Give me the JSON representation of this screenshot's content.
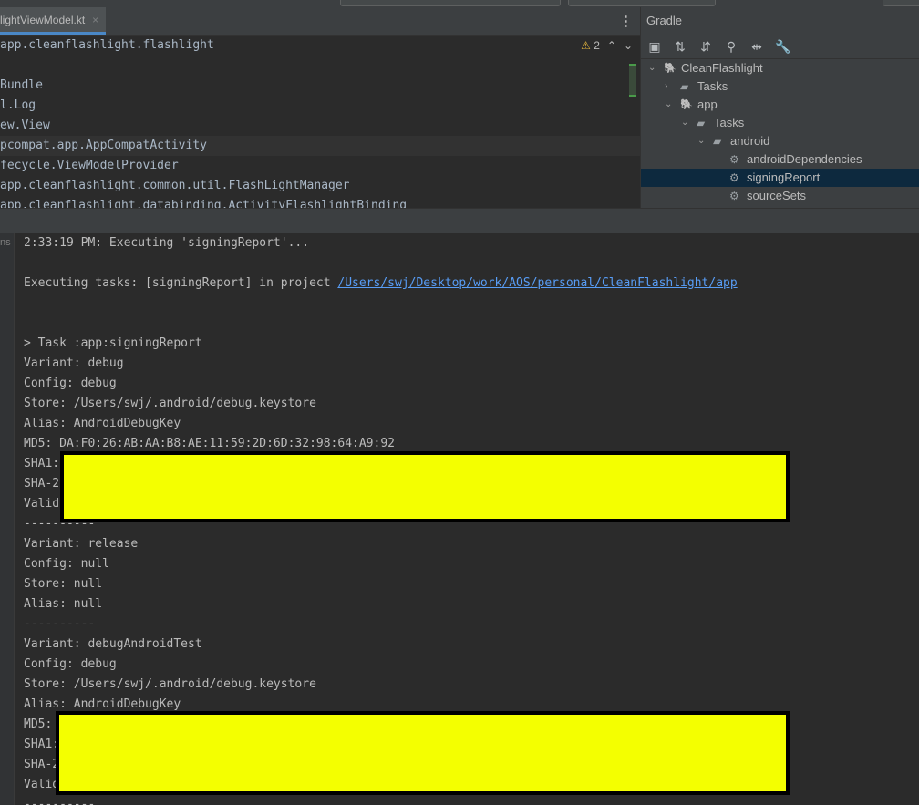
{
  "editor": {
    "tab_title": "lightViewModel.kt",
    "tab_close": "×",
    "menu_glyph": "⋮",
    "warning_icon": "warning-icon",
    "warning_count": "2",
    "nav_up": "⌃",
    "nav_down": "⌄",
    "lines": [
      "app.cleanflashlight.flashlight",
      "",
      "Bundle",
      "l.Log",
      "ew.View",
      "pcompat.app.AppCompatActivity",
      "fecycle.ViewModelProvider",
      "app.cleanflashlight.common.util.FlashLightManager",
      "app.cleanflashlight.databinding.ActivityFlashlightBinding"
    ]
  },
  "gradle": {
    "title": "Gradle",
    "tools": [
      "▣",
      "⇅",
      "⇵",
      "⚲",
      "⇹",
      "🔧"
    ],
    "tree": [
      {
        "label": "CleanFlashlight",
        "arrow": "⌄",
        "icon": "elephant-icon",
        "depth": 0,
        "selected": false
      },
      {
        "label": "Tasks",
        "arrow": "›",
        "icon": "folder-gear-icon",
        "depth": 1,
        "selected": false
      },
      {
        "label": "app",
        "arrow": "⌄",
        "icon": "elephant-icon",
        "depth": 1,
        "selected": false
      },
      {
        "label": "Tasks",
        "arrow": "⌄",
        "icon": "folder-gear-icon",
        "depth": 2,
        "selected": false
      },
      {
        "label": "android",
        "arrow": "⌄",
        "icon": "folder-gear-icon",
        "depth": 3,
        "selected": false
      },
      {
        "label": "androidDependencies",
        "arrow": "",
        "icon": "gear-icon",
        "depth": 4,
        "selected": false
      },
      {
        "label": "signingReport",
        "arrow": "",
        "icon": "gear-icon",
        "depth": 4,
        "selected": true
      },
      {
        "label": "sourceSets",
        "arrow": "",
        "icon": "gear-icon",
        "depth": 4,
        "selected": false
      }
    ]
  },
  "console": {
    "gutter_text": "ns",
    "line1": "2:33:19 PM: Executing 'signingReport'...",
    "exec_prefix": "Executing tasks: [signingReport] in project ",
    "exec_link": "/Users/swj/Desktop/work/AOS/personal/CleanFlashlight/app",
    "lines": [
      "> Task :app:signingReport",
      "Variant: debug",
      "Config: debug",
      "Store: /Users/swj/.android/debug.keystore",
      "Alias: AndroidDebugKey",
      "MD5: DA:F0:26:AB:AA:B8:AE:11:59:2D:6D:32:98:64:A9:92",
      "SHA1:",
      "SHA-25",
      "Valid",
      "----------",
      "Variant: release",
      "Config: null",
      "Store: null",
      "Alias: null",
      "----------",
      "Variant: debugAndroidTest",
      "Config: debug",
      "Store: /Users/swj/.android/debug.keystore",
      "Alias: AndroidDebugKey",
      "MD5:",
      "SHA1:",
      "SHA-2",
      "Valid",
      "----------"
    ]
  }
}
